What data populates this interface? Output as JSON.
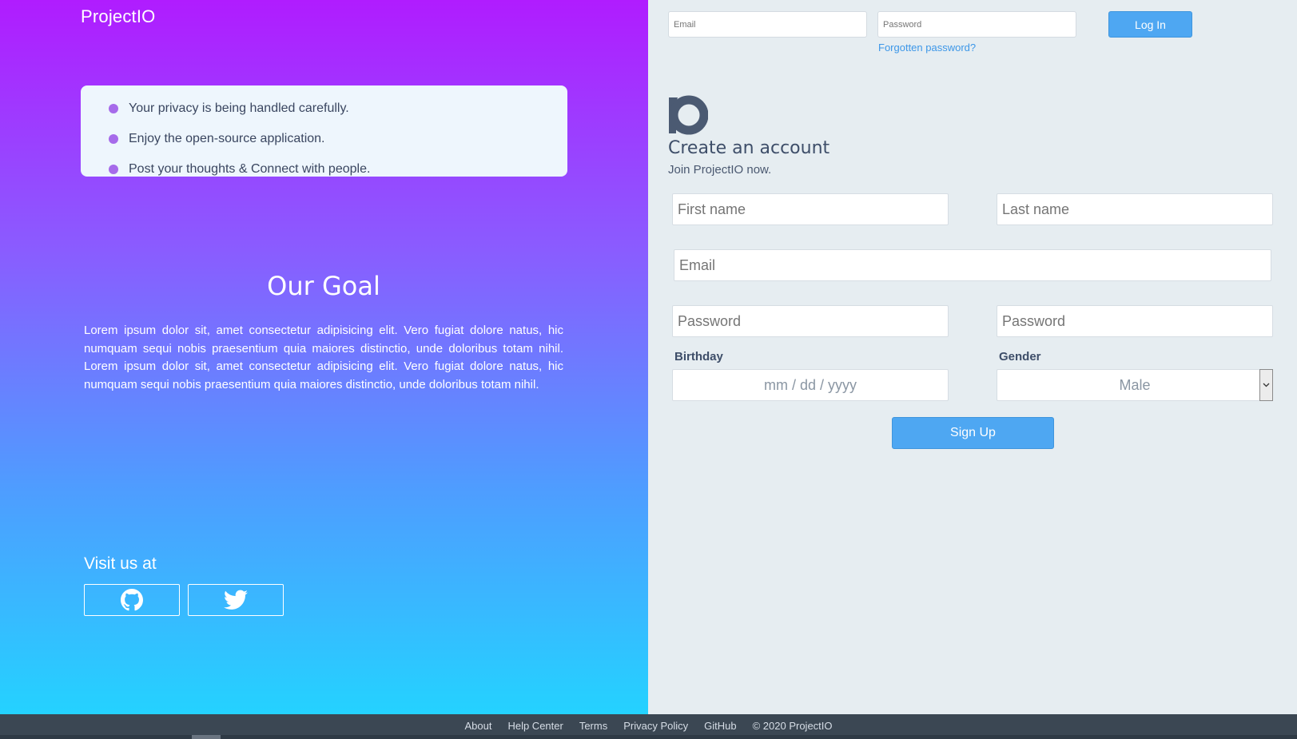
{
  "brand": {
    "name": "ProjectIO"
  },
  "features": [
    "Your privacy is being handled carefully.",
    "Enjoy the open-source application.",
    "Post your thoughts & Connect with people."
  ],
  "goal": {
    "title": "Our Goal",
    "text": "Lorem ipsum dolor sit, amet consectetur adipisicing elit. Vero fugiat dolore natus, hic numquam sequi nobis praesentium quia maiores distinctio, unde doloribus totam nihil. Lorem ipsum dolor sit, amet consectetur adipisicing elit. Vero fugiat dolore natus, hic numquam sequi nobis praesentium quia maiores distinctio, unde doloribus totam nihil."
  },
  "visit": {
    "title": "Visit us at",
    "icons": [
      "github-icon",
      "twitter-icon"
    ]
  },
  "login": {
    "email_placeholder": "Email",
    "password_placeholder": "Password",
    "button": "Log In",
    "forgot": "Forgotten password?"
  },
  "signup": {
    "title": "Create an account",
    "subtitle": "Join ProjectIO now.",
    "first_name_placeholder": "First name",
    "last_name_placeholder": "Last name",
    "email_placeholder": "Email",
    "password_placeholder": "Password",
    "confirm_password_placeholder": "Password",
    "birthday_label": "Birthday",
    "birthday_placeholder": "mm / dd / yyyy",
    "gender_label": "Gender",
    "gender_selected": "Male",
    "button": "Sign Up"
  },
  "footer": {
    "links": [
      "About",
      "Help Center",
      "Terms",
      "Privacy Policy",
      "GitHub"
    ],
    "copyright": "© 2020 ProjectIO"
  },
  "colors": {
    "accent": "#4ea7f2",
    "gradient_top": "#b01cff",
    "gradient_bottom": "#24d2ff",
    "footer": "#3b4753",
    "bullet": "#a66bea"
  }
}
